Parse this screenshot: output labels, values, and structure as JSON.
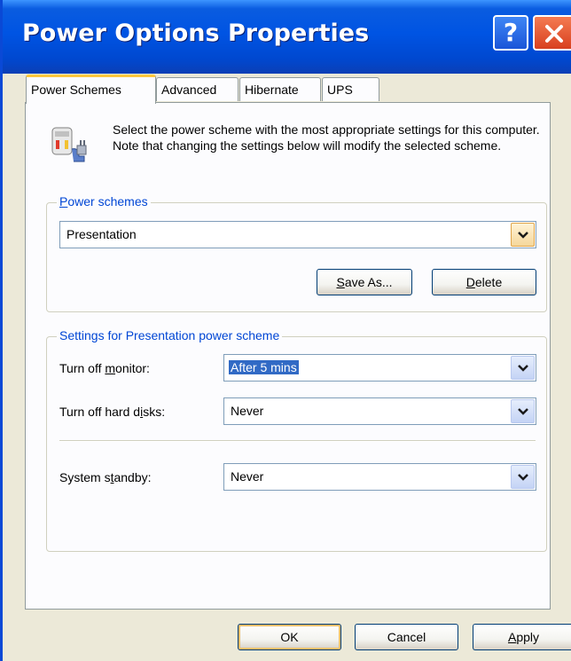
{
  "window": {
    "title": "Power Options Properties",
    "help_glyph": "?",
    "colors": {
      "titlebar": "#0054e3",
      "close": "#d8401f",
      "accent_tab": "#ffc83c",
      "group_label": "#0046d5"
    }
  },
  "tabs": [
    {
      "label": "Power Schemes",
      "active": true
    },
    {
      "label": "Advanced",
      "active": false
    },
    {
      "label": "Hibernate",
      "active": false
    },
    {
      "label": "UPS",
      "active": false
    }
  ],
  "description": "Select the power scheme with the most appropriate settings for this computer. Note that changing the settings below will modify the selected scheme.",
  "power_schemes": {
    "legend_prefix": "P",
    "legend_rest": "ower schemes",
    "selected": "Presentation",
    "save_as": {
      "prefix": "",
      "mnemonic": "S",
      "rest": "ave As..."
    },
    "delete": {
      "prefix": "",
      "mnemonic": "D",
      "rest": "elete"
    }
  },
  "settings": {
    "legend": "Settings for Presentation power scheme",
    "monitor": {
      "label_prefix": "Turn off ",
      "mnemonic": "m",
      "label_rest": "onitor:",
      "value": "After 5 mins"
    },
    "hard_disks": {
      "label_prefix": "Turn off hard d",
      "mnemonic": "i",
      "label_rest": "sks:",
      "value": "Never"
    },
    "standby": {
      "label_prefix": "System s",
      "mnemonic": "t",
      "label_rest": "andby:",
      "value": "Never"
    }
  },
  "footer": {
    "ok": "OK",
    "cancel": "Cancel",
    "apply_mnemonic": "A",
    "apply_rest": "pply"
  }
}
